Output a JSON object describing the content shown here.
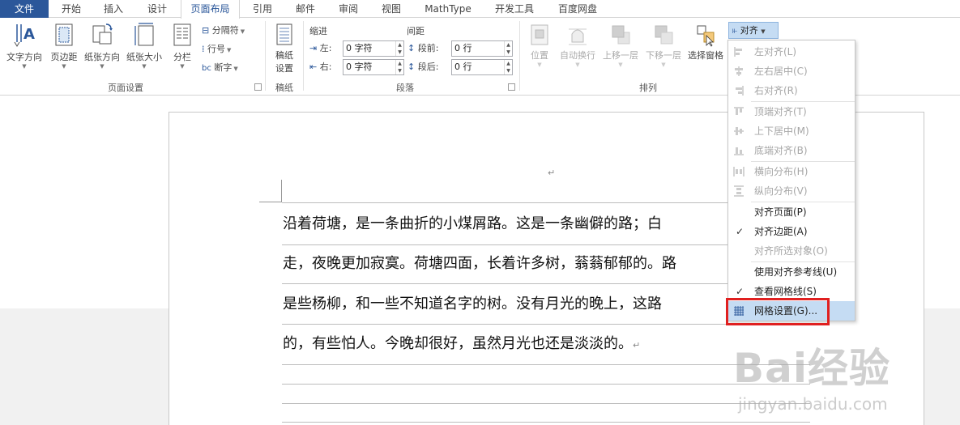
{
  "tabs": [
    {
      "label": "文件"
    },
    {
      "label": "开始"
    },
    {
      "label": "插入"
    },
    {
      "label": "设计"
    },
    {
      "label": "页面布局"
    },
    {
      "label": "引用"
    },
    {
      "label": "邮件"
    },
    {
      "label": "审阅"
    },
    {
      "label": "视图"
    },
    {
      "label": "MathType"
    },
    {
      "label": "开发工具"
    },
    {
      "label": "百度网盘"
    }
  ],
  "page_setup": {
    "text_direction": "文字方向",
    "margins": "页边距",
    "orientation": "纸张方向",
    "size": "纸张大小",
    "columns": "分栏",
    "breaks": "分隔符",
    "line_numbers": "行号",
    "hyphenation": "断字",
    "group_label": "页面设置"
  },
  "manuscript": {
    "button_line1": "稿纸",
    "button_line2": "设置",
    "group_label": "稿纸"
  },
  "paragraph": {
    "indent_title": "缩进",
    "spacing_title": "间距",
    "left_label": "左:",
    "right_label": "右:",
    "before_label": "段前:",
    "after_label": "段后:",
    "left_value": "0 字符",
    "right_value": "0 字符",
    "before_value": "0 行",
    "after_value": "0 行",
    "group_label": "段落"
  },
  "arrange": {
    "position": "位置",
    "wrap_text": "自动换行",
    "bring_forward": "上移一层",
    "send_backward": "下移一层",
    "selection_pane": "选择窗格",
    "align_button": "对齐",
    "group_label": "排列"
  },
  "align_menu": {
    "items": [
      {
        "label": "左对齐(L)"
      },
      {
        "label": "左右居中(C)"
      },
      {
        "label": "右对齐(R)"
      },
      {
        "label": "顶端对齐(T)"
      },
      {
        "label": "上下居中(M)"
      },
      {
        "label": "底端对齐(B)"
      },
      {
        "label": "横向分布(H)"
      },
      {
        "label": "纵向分布(V)"
      },
      {
        "label": "对齐页面(P)"
      },
      {
        "label": "对齐边距(A)"
      },
      {
        "label": "对齐所选对象(O)"
      },
      {
        "label": "使用对齐参考线(U)"
      },
      {
        "label": "查看网格线(S)"
      },
      {
        "label": "网格设置(G)..."
      }
    ]
  },
  "document": {
    "lines": [
      "沿着荷塘，是一条曲折的小煤屑路。这是一条幽僻的路；白",
      "走，夜晚更加寂寞。荷塘四面，长着许多树，蓊蓊郁郁的。路",
      "是些杨柳，和一些不知道名字的树。没有月光的晚上，这路",
      "的，有些怕人。今晚却很好，虽然月光也还是淡淡的。"
    ]
  },
  "watermark": {
    "brand": "Bai经验",
    "url": "jingyan.baidu.com"
  },
  "colors": {
    "file_tab": "#2b579a",
    "highlight": "#c5dcf3",
    "callout": "#e02020"
  }
}
